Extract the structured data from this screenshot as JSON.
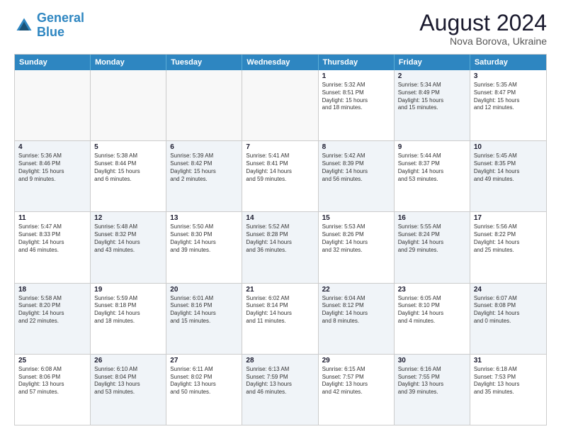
{
  "header": {
    "logo_line1": "General",
    "logo_line2": "Blue",
    "month_year": "August 2024",
    "location": "Nova Borova, Ukraine"
  },
  "days_of_week": [
    "Sunday",
    "Monday",
    "Tuesday",
    "Wednesday",
    "Thursday",
    "Friday",
    "Saturday"
  ],
  "weeks": [
    [
      {
        "day": "",
        "info": "",
        "shaded": false
      },
      {
        "day": "",
        "info": "",
        "shaded": false
      },
      {
        "day": "",
        "info": "",
        "shaded": false
      },
      {
        "day": "",
        "info": "",
        "shaded": false
      },
      {
        "day": "1",
        "info": "Sunrise: 5:32 AM\nSunset: 8:51 PM\nDaylight: 15 hours\nand 18 minutes.",
        "shaded": false
      },
      {
        "day": "2",
        "info": "Sunrise: 5:34 AM\nSunset: 8:49 PM\nDaylight: 15 hours\nand 15 minutes.",
        "shaded": true
      },
      {
        "day": "3",
        "info": "Sunrise: 5:35 AM\nSunset: 8:47 PM\nDaylight: 15 hours\nand 12 minutes.",
        "shaded": false
      }
    ],
    [
      {
        "day": "4",
        "info": "Sunrise: 5:36 AM\nSunset: 8:46 PM\nDaylight: 15 hours\nand 9 minutes.",
        "shaded": true
      },
      {
        "day": "5",
        "info": "Sunrise: 5:38 AM\nSunset: 8:44 PM\nDaylight: 15 hours\nand 6 minutes.",
        "shaded": false
      },
      {
        "day": "6",
        "info": "Sunrise: 5:39 AM\nSunset: 8:42 PM\nDaylight: 15 hours\nand 2 minutes.",
        "shaded": true
      },
      {
        "day": "7",
        "info": "Sunrise: 5:41 AM\nSunset: 8:41 PM\nDaylight: 14 hours\nand 59 minutes.",
        "shaded": false
      },
      {
        "day": "8",
        "info": "Sunrise: 5:42 AM\nSunset: 8:39 PM\nDaylight: 14 hours\nand 56 minutes.",
        "shaded": true
      },
      {
        "day": "9",
        "info": "Sunrise: 5:44 AM\nSunset: 8:37 PM\nDaylight: 14 hours\nand 53 minutes.",
        "shaded": false
      },
      {
        "day": "10",
        "info": "Sunrise: 5:45 AM\nSunset: 8:35 PM\nDaylight: 14 hours\nand 49 minutes.",
        "shaded": true
      }
    ],
    [
      {
        "day": "11",
        "info": "Sunrise: 5:47 AM\nSunset: 8:33 PM\nDaylight: 14 hours\nand 46 minutes.",
        "shaded": false
      },
      {
        "day": "12",
        "info": "Sunrise: 5:48 AM\nSunset: 8:32 PM\nDaylight: 14 hours\nand 43 minutes.",
        "shaded": true
      },
      {
        "day": "13",
        "info": "Sunrise: 5:50 AM\nSunset: 8:30 PM\nDaylight: 14 hours\nand 39 minutes.",
        "shaded": false
      },
      {
        "day": "14",
        "info": "Sunrise: 5:52 AM\nSunset: 8:28 PM\nDaylight: 14 hours\nand 36 minutes.",
        "shaded": true
      },
      {
        "day": "15",
        "info": "Sunrise: 5:53 AM\nSunset: 8:26 PM\nDaylight: 14 hours\nand 32 minutes.",
        "shaded": false
      },
      {
        "day": "16",
        "info": "Sunrise: 5:55 AM\nSunset: 8:24 PM\nDaylight: 14 hours\nand 29 minutes.",
        "shaded": true
      },
      {
        "day": "17",
        "info": "Sunrise: 5:56 AM\nSunset: 8:22 PM\nDaylight: 14 hours\nand 25 minutes.",
        "shaded": false
      }
    ],
    [
      {
        "day": "18",
        "info": "Sunrise: 5:58 AM\nSunset: 8:20 PM\nDaylight: 14 hours\nand 22 minutes.",
        "shaded": true
      },
      {
        "day": "19",
        "info": "Sunrise: 5:59 AM\nSunset: 8:18 PM\nDaylight: 14 hours\nand 18 minutes.",
        "shaded": false
      },
      {
        "day": "20",
        "info": "Sunrise: 6:01 AM\nSunset: 8:16 PM\nDaylight: 14 hours\nand 15 minutes.",
        "shaded": true
      },
      {
        "day": "21",
        "info": "Sunrise: 6:02 AM\nSunset: 8:14 PM\nDaylight: 14 hours\nand 11 minutes.",
        "shaded": false
      },
      {
        "day": "22",
        "info": "Sunrise: 6:04 AM\nSunset: 8:12 PM\nDaylight: 14 hours\nand 8 minutes.",
        "shaded": true
      },
      {
        "day": "23",
        "info": "Sunrise: 6:05 AM\nSunset: 8:10 PM\nDaylight: 14 hours\nand 4 minutes.",
        "shaded": false
      },
      {
        "day": "24",
        "info": "Sunrise: 6:07 AM\nSunset: 8:08 PM\nDaylight: 14 hours\nand 0 minutes.",
        "shaded": true
      }
    ],
    [
      {
        "day": "25",
        "info": "Sunrise: 6:08 AM\nSunset: 8:06 PM\nDaylight: 13 hours\nand 57 minutes.",
        "shaded": false
      },
      {
        "day": "26",
        "info": "Sunrise: 6:10 AM\nSunset: 8:04 PM\nDaylight: 13 hours\nand 53 minutes.",
        "shaded": true
      },
      {
        "day": "27",
        "info": "Sunrise: 6:11 AM\nSunset: 8:02 PM\nDaylight: 13 hours\nand 50 minutes.",
        "shaded": false
      },
      {
        "day": "28",
        "info": "Sunrise: 6:13 AM\nSunset: 7:59 PM\nDaylight: 13 hours\nand 46 minutes.",
        "shaded": true
      },
      {
        "day": "29",
        "info": "Sunrise: 6:15 AM\nSunset: 7:57 PM\nDaylight: 13 hours\nand 42 minutes.",
        "shaded": false
      },
      {
        "day": "30",
        "info": "Sunrise: 6:16 AM\nSunset: 7:55 PM\nDaylight: 13 hours\nand 39 minutes.",
        "shaded": true
      },
      {
        "day": "31",
        "info": "Sunrise: 6:18 AM\nSunset: 7:53 PM\nDaylight: 13 hours\nand 35 minutes.",
        "shaded": false
      }
    ]
  ]
}
